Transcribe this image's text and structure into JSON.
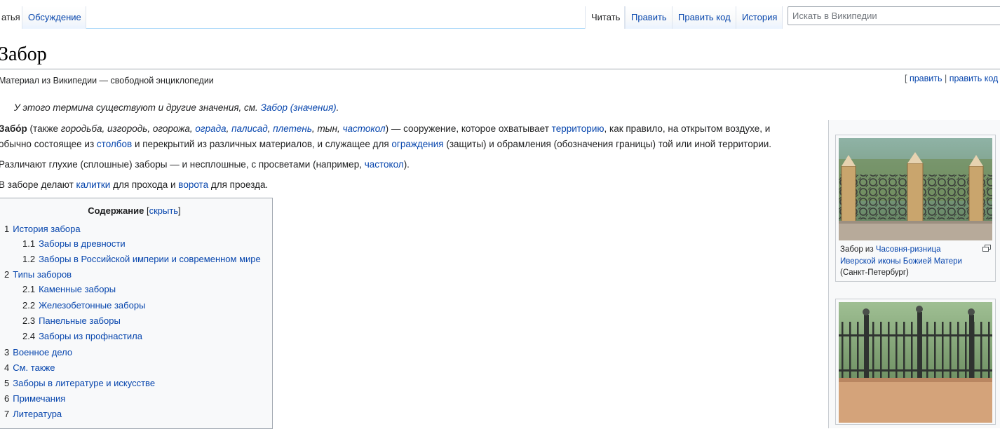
{
  "tabs": {
    "article": "атья",
    "talk": "Обсуждение",
    "read": "Читать",
    "edit": "Править",
    "edit_source": "Править код",
    "history": "История"
  },
  "search": {
    "placeholder": "Искать в Википедии"
  },
  "page": {
    "title": "Забор",
    "tagline": "Материал из Википедии — свободной энциклопедии",
    "edit_links": {
      "open": "[ ",
      "edit": "править",
      "sep": " | ",
      "edit_source": "править код"
    }
  },
  "hatnote": {
    "text": "У этого термина существуют и другие значения, см. ",
    "link": "Забор (значения)",
    "end": "."
  },
  "para1": {
    "bold": "Забо́р",
    "t1": " (также ",
    "i1": "городьба, изгородь, огорожа, ",
    "l1": "ограда",
    "c1": ", ",
    "l2": "палисад",
    "c2": ", ",
    "l3": "плетень",
    "c3": ", ",
    "i2": "тын",
    "c4": ", ",
    "l4": "частокол",
    "t2": ") — сооружение, которое охватывает ",
    "l5": "территорию",
    "t3": ", как правило, на открытом воздухе, и",
    "t4": "обычно состоящее из ",
    "l6": "столбов",
    "t5": " и перекрытий из различных материалов, и служащее для ",
    "l7": "ограждения",
    "t6": " (защиты) и обрамления (обозначения границы) той или иной территории."
  },
  "para2": {
    "t1": "Различают глухие (сплошные) заборы — и несплошные, с просветами (например, ",
    "l1": "частокол",
    "t2": ")."
  },
  "para3": {
    "t1": "В заборе делают ",
    "l1": "калитки",
    "t2": " для прохода и ",
    "l2": "ворота",
    "t3": " для проезда."
  },
  "toc": {
    "title": "Содержание",
    "toggle_open": " [",
    "toggle": "скрыть",
    "toggle_close": "]",
    "items": [
      {
        "num": "1",
        "label": "История забора"
      },
      {
        "num": "1.1",
        "label": "Заборы в древности"
      },
      {
        "num": "1.2",
        "label": "Заборы в Российской империи и современном мире"
      },
      {
        "num": "2",
        "label": "Типы заборов"
      },
      {
        "num": "2.1",
        "label": "Каменные заборы"
      },
      {
        "num": "2.2",
        "label": "Железобетонные заборы"
      },
      {
        "num": "2.3",
        "label": "Панельные заборы"
      },
      {
        "num": "2.4",
        "label": "Заборы из профнастила"
      },
      {
        "num": "3",
        "label": "Военное дело"
      },
      {
        "num": "4",
        "label": "См. также"
      },
      {
        "num": "5",
        "label": "Заборы в литературе и искусстве"
      },
      {
        "num": "6",
        "label": "Примечания"
      },
      {
        "num": "7",
        "label": "Литература"
      }
    ]
  },
  "thumb1": {
    "caption_prefix": "Забор из ",
    "caption_link": "Часовня-ризница Иверской иконы Божией Матери",
    "caption_suffix": " (Санкт-Петербург)"
  },
  "colors": {
    "link": "#0645ad",
    "border": "#a2a9b1",
    "tab_line": "#a7d7f9"
  }
}
